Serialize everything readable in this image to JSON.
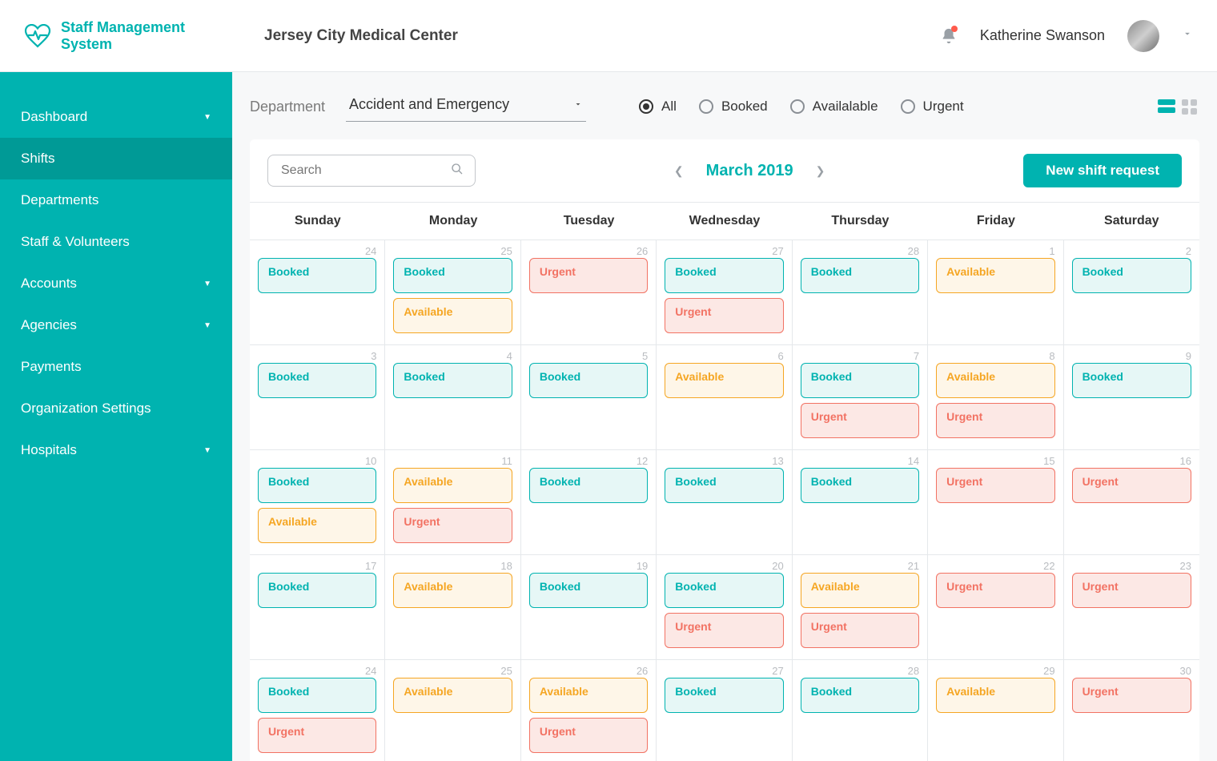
{
  "header": {
    "app_name": "Staff Management System",
    "org_name": "Jersey City Medical Center",
    "user_name": "Katherine Swanson"
  },
  "sidebar": {
    "items": [
      {
        "label": "Dashboard",
        "expandable": true,
        "active": false
      },
      {
        "label": "Shifts",
        "expandable": false,
        "active": true
      },
      {
        "label": "Departments",
        "expandable": false,
        "active": false
      },
      {
        "label": "Staff & Volunteers",
        "expandable": false,
        "active": false
      },
      {
        "label": "Accounts",
        "expandable": true,
        "active": false
      },
      {
        "label": "Agencies",
        "expandable": true,
        "active": false
      },
      {
        "label": "Payments",
        "expandable": false,
        "active": false
      },
      {
        "label": "Organization Settings",
        "expandable": false,
        "active": false
      },
      {
        "label": "Hospitals",
        "expandable": true,
        "active": false
      }
    ]
  },
  "controls": {
    "department_label": "Department",
    "department_value": "Accident and Emergency",
    "filters": [
      {
        "label": "All",
        "active": true
      },
      {
        "label": "Booked",
        "active": false
      },
      {
        "label": "Availalable",
        "active": false
      },
      {
        "label": "Urgent",
        "active": false
      }
    ]
  },
  "toolbar": {
    "search_placeholder": "Search",
    "month": "March 2019",
    "new_shift_label": "New shift request"
  },
  "weekdays": [
    "Sunday",
    "Monday",
    "Tuesday",
    "Wednesday",
    "Thursday",
    "Friday",
    "Saturday"
  ],
  "shift_labels": {
    "booked": "Booked",
    "available": "Available",
    "urgent": "Urgent"
  },
  "calendar": [
    {
      "date": "24",
      "shifts": [
        "booked"
      ]
    },
    {
      "date": "25",
      "shifts": [
        "booked",
        "available"
      ]
    },
    {
      "date": "26",
      "shifts": [
        "urgent"
      ]
    },
    {
      "date": "27",
      "shifts": [
        "booked",
        "urgent"
      ]
    },
    {
      "date": "28",
      "shifts": [
        "booked"
      ]
    },
    {
      "date": "1",
      "shifts": [
        "available"
      ]
    },
    {
      "date": "2",
      "shifts": [
        "booked"
      ]
    },
    {
      "date": "3",
      "shifts": [
        "booked"
      ]
    },
    {
      "date": "4",
      "shifts": [
        "booked"
      ]
    },
    {
      "date": "5",
      "shifts": [
        "booked"
      ]
    },
    {
      "date": "6",
      "shifts": [
        "available"
      ]
    },
    {
      "date": "7",
      "shifts": [
        "booked",
        "urgent"
      ]
    },
    {
      "date": "8",
      "shifts": [
        "available",
        "urgent"
      ]
    },
    {
      "date": "9",
      "shifts": [
        "booked"
      ]
    },
    {
      "date": "10",
      "shifts": [
        "booked",
        "available"
      ]
    },
    {
      "date": "11",
      "shifts": [
        "available",
        "urgent"
      ]
    },
    {
      "date": "12",
      "shifts": [
        "booked"
      ]
    },
    {
      "date": "13",
      "shifts": [
        "booked"
      ]
    },
    {
      "date": "14",
      "shifts": [
        "booked"
      ]
    },
    {
      "date": "15",
      "shifts": [
        "urgent"
      ]
    },
    {
      "date": "16",
      "shifts": [
        "urgent"
      ]
    },
    {
      "date": "17",
      "shifts": [
        "booked"
      ]
    },
    {
      "date": "18",
      "shifts": [
        "available"
      ]
    },
    {
      "date": "19",
      "shifts": [
        "booked"
      ]
    },
    {
      "date": "20",
      "shifts": [
        "booked",
        "urgent"
      ]
    },
    {
      "date": "21",
      "shifts": [
        "available",
        "urgent"
      ]
    },
    {
      "date": "22",
      "shifts": [
        "urgent"
      ]
    },
    {
      "date": "23",
      "shifts": [
        "urgent"
      ]
    },
    {
      "date": "24",
      "shifts": [
        "booked",
        "urgent"
      ]
    },
    {
      "date": "25",
      "shifts": [
        "available"
      ]
    },
    {
      "date": "26",
      "shifts": [
        "available",
        "urgent"
      ]
    },
    {
      "date": "27",
      "shifts": [
        "booked"
      ]
    },
    {
      "date": "28",
      "shifts": [
        "booked"
      ]
    },
    {
      "date": "29",
      "shifts": [
        "available"
      ]
    },
    {
      "date": "30",
      "shifts": [
        "urgent"
      ]
    }
  ]
}
